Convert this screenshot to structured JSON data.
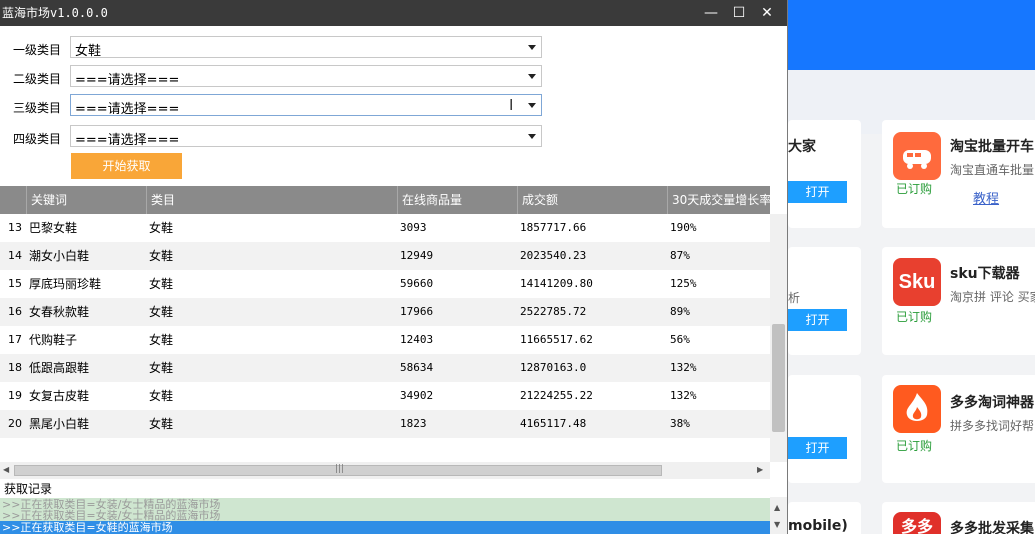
{
  "window": {
    "title": "蓝海市场v1.0.0.0",
    "minimize_glyph": "—",
    "maximize_glyph": "☐",
    "close_glyph": "✕"
  },
  "form": {
    "level1": {
      "label": "一级类目",
      "value": "女鞋"
    },
    "level2": {
      "label": "二级类目",
      "value": "===请选择==="
    },
    "level3": {
      "label": "三级类目",
      "value": "===请选择==="
    },
    "level4": {
      "label": "四级类目",
      "value": "===请选择==="
    },
    "start_label": "开始获取"
  },
  "table": {
    "columns": [
      "关键词",
      "类目",
      "在线商品量",
      "成交额",
      "30天成交量增长率"
    ],
    "rows": [
      {
        "index": "13",
        "keyword": "巴黎女鞋",
        "category": "女鞋",
        "online": "3093",
        "amount": "1857717.66",
        "growth": "190%"
      },
      {
        "index": "14",
        "keyword": "潮女小白鞋",
        "category": "女鞋",
        "online": "12949",
        "amount": "2023540.23",
        "growth": "87%"
      },
      {
        "index": "15",
        "keyword": "厚底玛丽珍鞋",
        "category": "女鞋",
        "online": "59660",
        "amount": "14141209.80",
        "growth": "125%"
      },
      {
        "index": "16",
        "keyword": "女春秋款鞋",
        "category": "女鞋",
        "online": "17966",
        "amount": "2522785.72",
        "growth": "89%"
      },
      {
        "index": "17",
        "keyword": "代购鞋子",
        "category": "女鞋",
        "online": "12403",
        "amount": "11665517.62",
        "growth": "56%"
      },
      {
        "index": "18",
        "keyword": "低跟高跟鞋",
        "category": "女鞋",
        "online": "58634",
        "amount": "12870163.0",
        "growth": "132%"
      },
      {
        "index": "19",
        "keyword": "女复古皮鞋",
        "category": "女鞋",
        "online": "34902",
        "amount": "21224255.22",
        "growth": "132%"
      },
      {
        "index": "20",
        "keyword": "黑尾小白鞋",
        "category": "女鞋",
        "online": "1823",
        "amount": "4165117.48",
        "growth": "38%"
      }
    ]
  },
  "log": {
    "label": "获取记录",
    "lines": [
      ">>正在获取类目=女装/女士精品的蓝海市场",
      ">>正在获取类目=女装/女士精品的蓝海市场",
      ">>正在获取类目=女鞋的蓝海市场"
    ]
  },
  "background_app": {
    "cards": [
      {
        "title": "大家",
        "open_label": "打开"
      },
      {
        "title": "淘宝批量开车",
        "desc": "淘宝直通车批量",
        "status": "已订购",
        "link": "教程"
      },
      {
        "desc": "析",
        "open_label": "打开"
      },
      {
        "title": "sku下载器",
        "icon_text": "Sku",
        "desc": "淘京拼 评论 买家",
        "status": "已订购"
      },
      {
        "open_label": "打开"
      },
      {
        "title": "多多淘词神器",
        "desc": "拼多多找词好帮",
        "status": "已订购"
      },
      {
        "title": "mobile)"
      },
      {
        "title": "多多批发采集",
        "icon_text": "多多"
      }
    ],
    "colors": {
      "accent": "#1677ff",
      "open_button": "#1e9fff",
      "subscribed": "#2a9d3a",
      "start_button": "#f9a638"
    }
  }
}
